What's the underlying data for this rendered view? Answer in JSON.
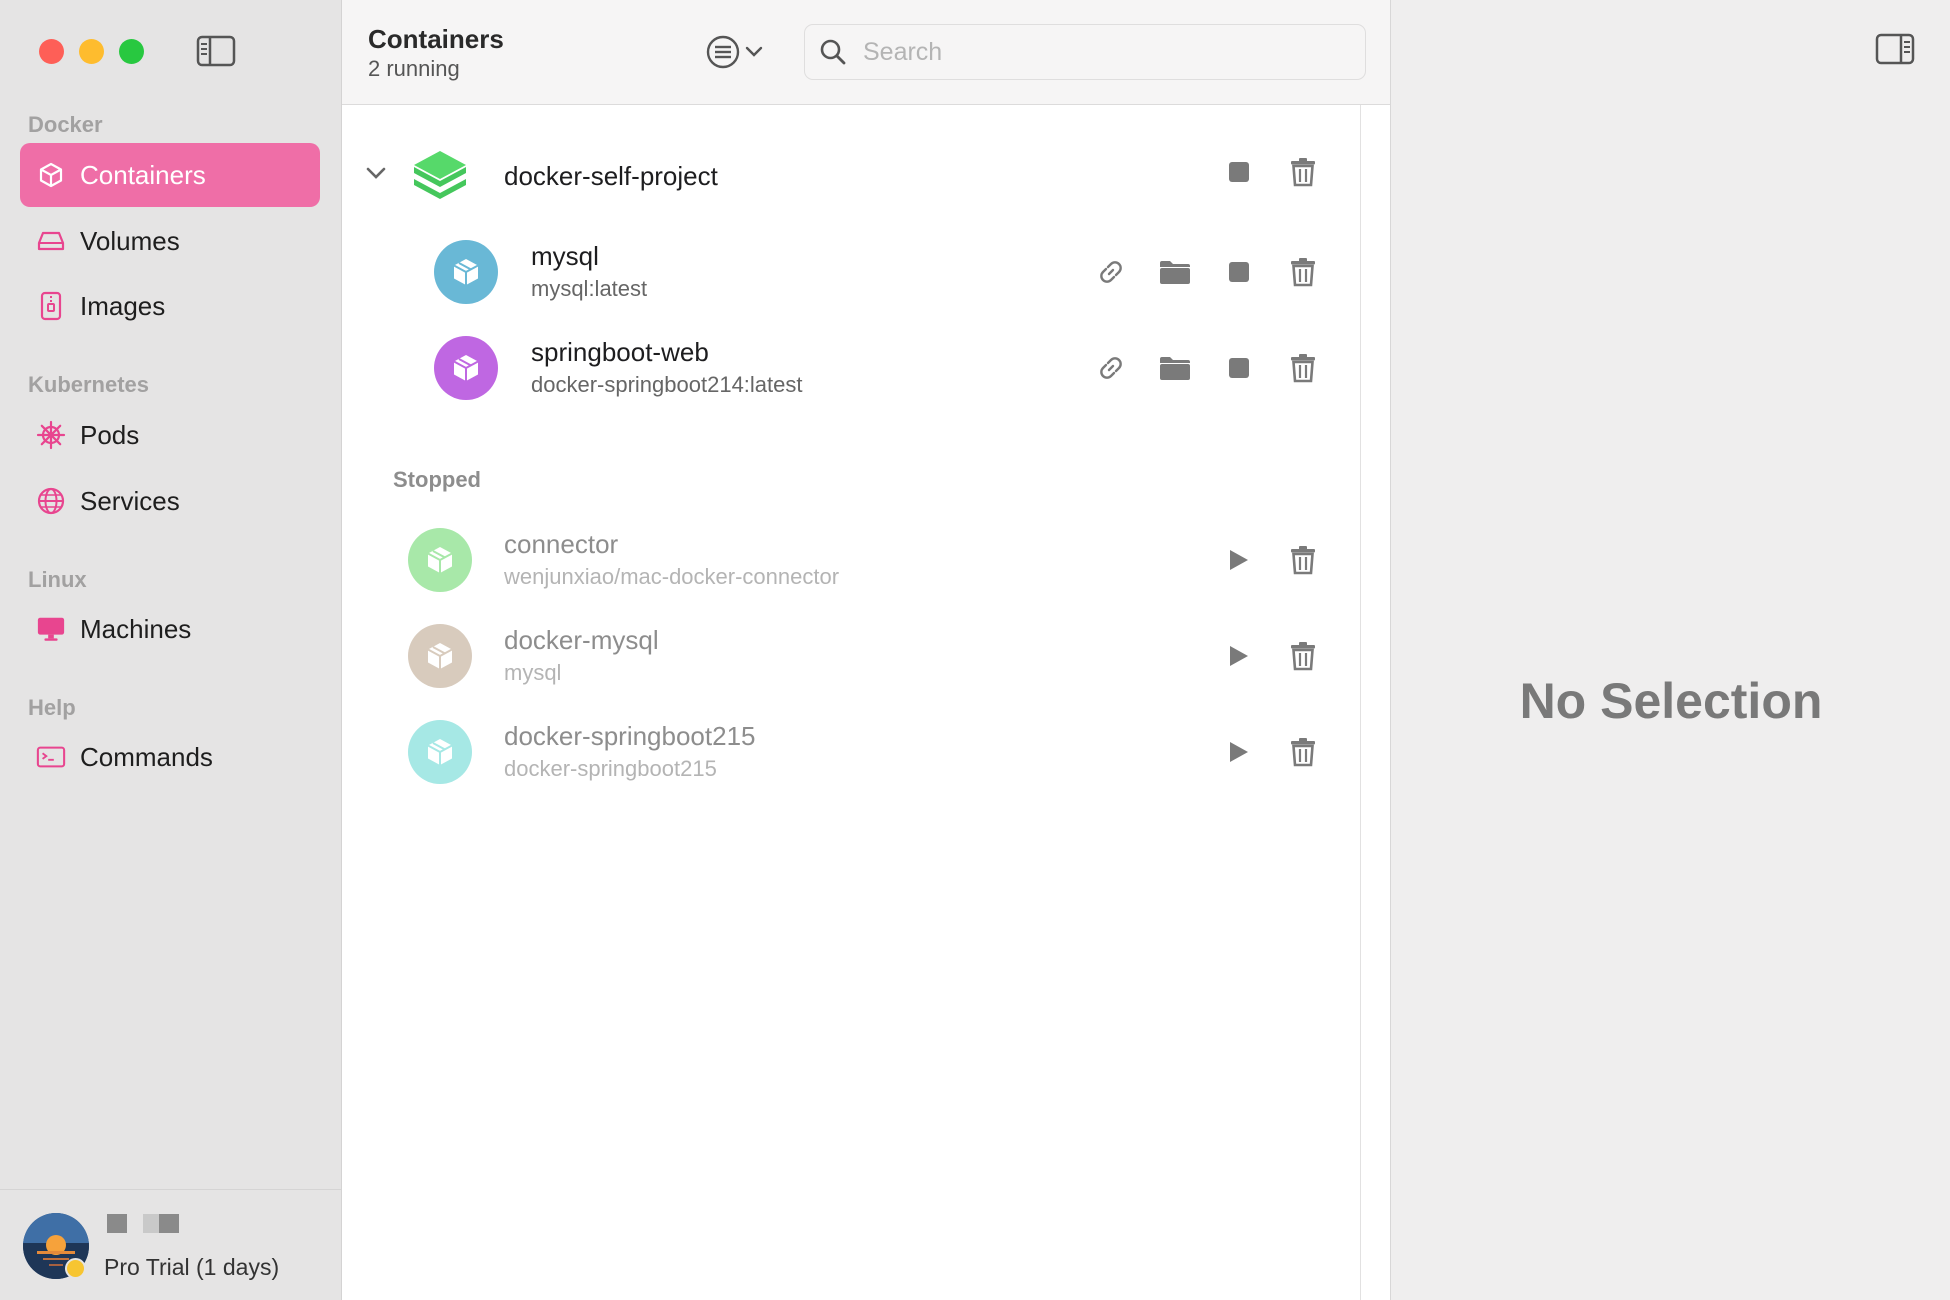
{
  "sidebar": {
    "sections": [
      {
        "label": "Docker"
      },
      {
        "label": "Kubernetes"
      },
      {
        "label": "Linux"
      },
      {
        "label": "Help"
      }
    ],
    "items": [
      {
        "label": "Containers",
        "icon": "cube-icon"
      },
      {
        "label": "Volumes",
        "icon": "drive-icon"
      },
      {
        "label": "Images",
        "icon": "archive-icon"
      },
      {
        "label": "Pods",
        "icon": "helm-icon"
      },
      {
        "label": "Services",
        "icon": "globe-icon"
      },
      {
        "label": "Machines",
        "icon": "desktop-icon"
      },
      {
        "label": "Commands",
        "icon": "terminal-icon"
      }
    ],
    "active_color": "#ef6ea7",
    "icon_color": "#e8458f",
    "footer": {
      "plan": "Pro Trial (1 days)"
    }
  },
  "toolbar": {
    "title": "Containers",
    "subtitle": "2 running",
    "search_placeholder": "Search"
  },
  "group": {
    "name": "docker-self-project",
    "icon_color": "#4cd364"
  },
  "running": [
    {
      "name": "mysql",
      "image": "mysql:latest",
      "color": "#69b8d6"
    },
    {
      "name": "springboot-web",
      "image": "docker-springboot214:latest",
      "color": "#bf67e2"
    }
  ],
  "stopped_label": "Stopped",
  "stopped": [
    {
      "name": "connector",
      "image": "wenjunxiao/mac-docker-connector",
      "color": "#a8e8a9"
    },
    {
      "name": "docker-mysql",
      "image": "mysql",
      "color": "#d8cbbd"
    },
    {
      "name": "docker-springboot215",
      "image": "docker-springboot215",
      "color": "#a6e8e5"
    }
  ],
  "detail": {
    "empty_text": "No Selection"
  }
}
